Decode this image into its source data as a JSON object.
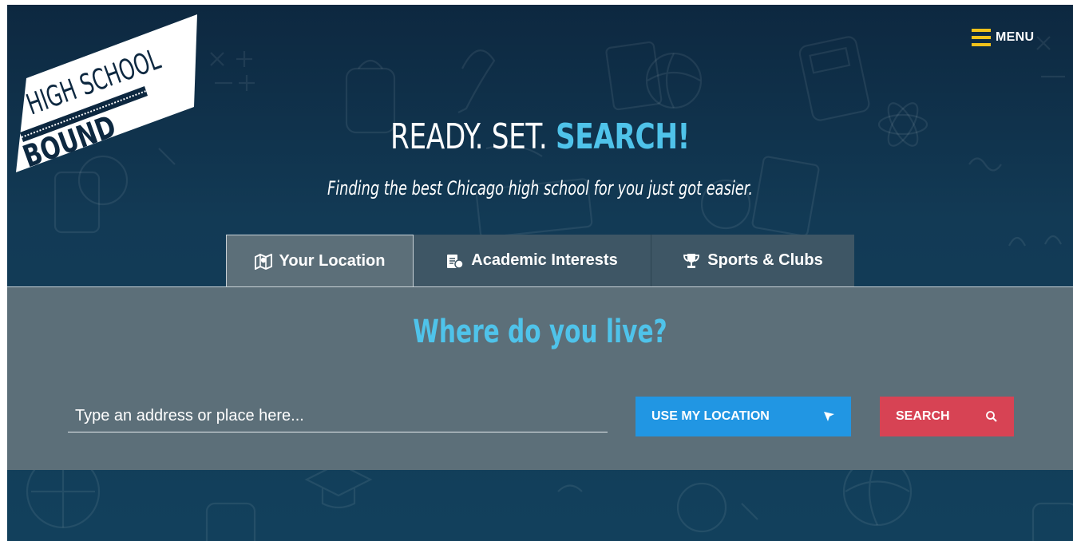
{
  "brand": {
    "logo_line1": "HIGH SCHOOL",
    "logo_line2": "BOUND"
  },
  "header": {
    "menu_label": "MENU"
  },
  "hero": {
    "title_plain": "READY. SET. ",
    "title_accent": "SEARCH!",
    "subtitle": "Finding the best Chicago high school for you just got easier."
  },
  "tabs": [
    {
      "label": "Your Location",
      "icon": "map-icon",
      "active": true
    },
    {
      "label": "Academic Interests",
      "icon": "academic-icon",
      "active": false
    },
    {
      "label": "Sports & Clubs",
      "icon": "trophy-icon",
      "active": false
    }
  ],
  "search": {
    "question": "Where do you live?",
    "placeholder": "Type an address or place here...",
    "use_location_label": "USE MY LOCATION",
    "search_label": "SEARCH"
  },
  "colors": {
    "accent": "#4fc3ea",
    "menu_icon": "#f1c21b",
    "location_button": "#2196e3",
    "search_button": "#d74354",
    "panel": "#5c6f79"
  }
}
